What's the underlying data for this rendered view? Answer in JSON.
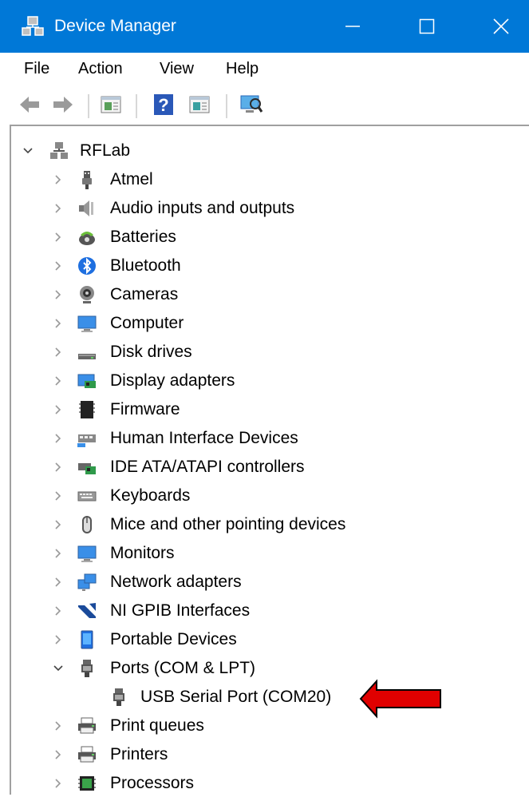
{
  "window": {
    "title": "Device Manager",
    "controls": {
      "minimize": "minimize",
      "maximize": "maximize",
      "close": "close"
    }
  },
  "menu": [
    "File",
    "Action",
    "View",
    "Help"
  ],
  "toolbar": [
    "back-arrow-icon",
    "forward-arrow-icon",
    "properties-icon",
    "help-icon",
    "update-driver-icon",
    "scan-hardware-icon"
  ],
  "tree": {
    "root": "RFLab",
    "categories": [
      "Atmel",
      "Audio inputs and outputs",
      "Batteries",
      "Bluetooth",
      "Cameras",
      "Computer",
      "Disk drives",
      "Display adapters",
      "Firmware",
      "Human Interface Devices",
      "IDE ATA/ATAPI controllers",
      "Keyboards",
      "Mice and other pointing devices",
      "Monitors",
      "Network adapters",
      "NI GPIB Interfaces",
      "Portable Devices",
      "Ports (COM & LPT)",
      "Print queues",
      "Printers",
      "Processors"
    ],
    "ports_child": "USB Serial Port (COM20)"
  },
  "colors": {
    "titlebar": "#0078d7",
    "annotation_arrow": "#e00000"
  }
}
